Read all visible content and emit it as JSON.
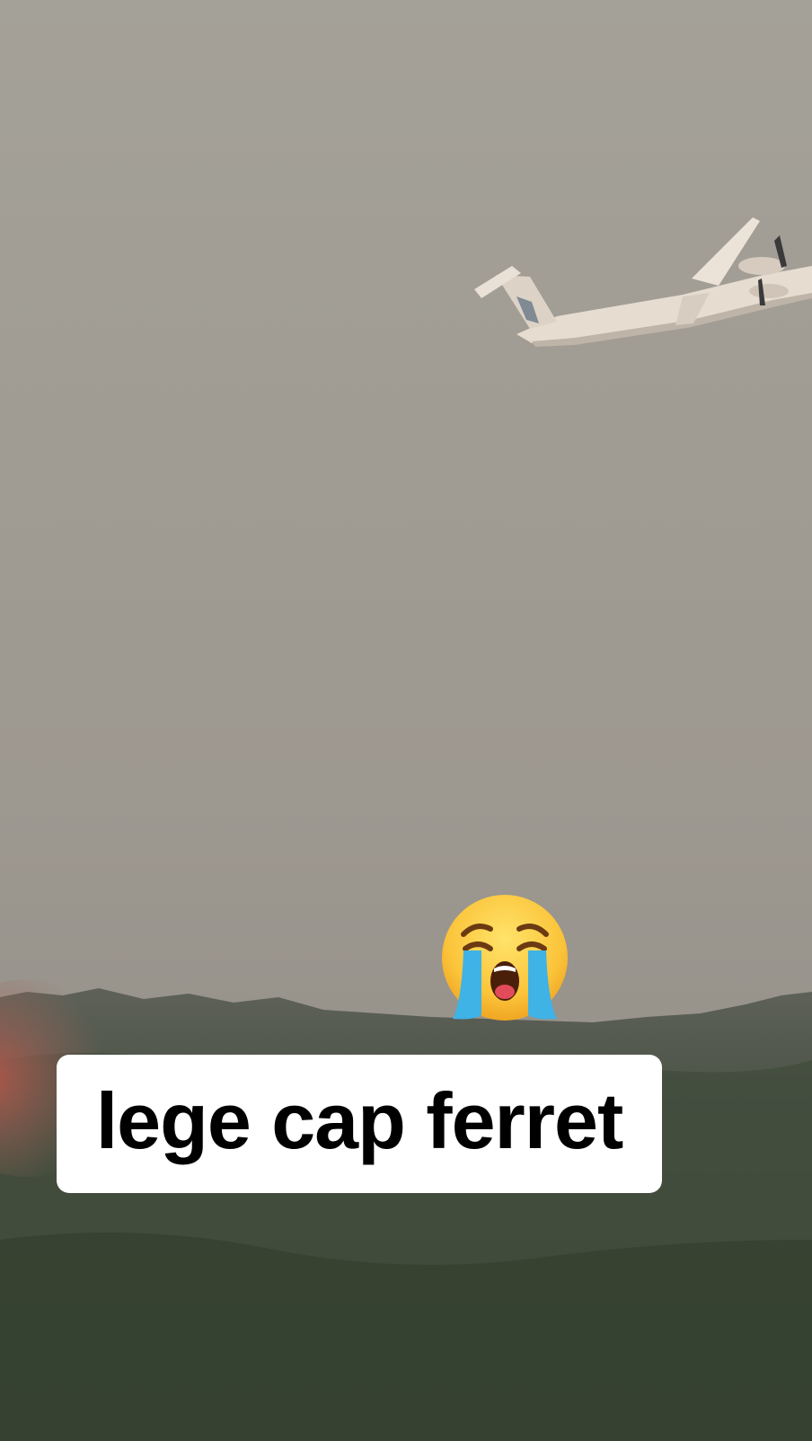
{
  "video": {
    "scene": "airplane-over-smoky-forest",
    "sticker_icon": "loudly-crying-face-emoji",
    "caption": "lege cap ferret"
  },
  "colors": {
    "sky": "#a19e98",
    "forest": "#3f4a3b",
    "caption_bg": "#ffffff",
    "caption_text": "#000000"
  }
}
